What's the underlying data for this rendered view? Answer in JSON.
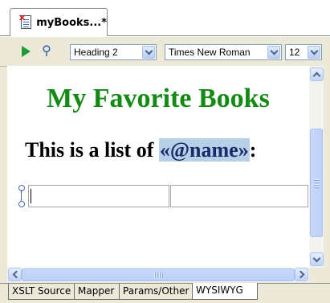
{
  "document_tab": {
    "label": "myBooks...*"
  },
  "toolbar": {
    "style_combo": "Heading 2",
    "font_combo": "Times New Roman",
    "size_combo": "12"
  },
  "editor": {
    "heading": "My Favorite Books",
    "line_prefix": "This is a list of ",
    "placeholder": "«@name»",
    "line_suffix": ":"
  },
  "view_tabs": [
    "XSLT Source",
    "Mapper",
    "Params/Other",
    "WYSIWYG"
  ],
  "active_view_tab": "WYSIWYG",
  "colors": {
    "heading": "#138a13",
    "placeholder_highlight": "#b8cfe8"
  }
}
